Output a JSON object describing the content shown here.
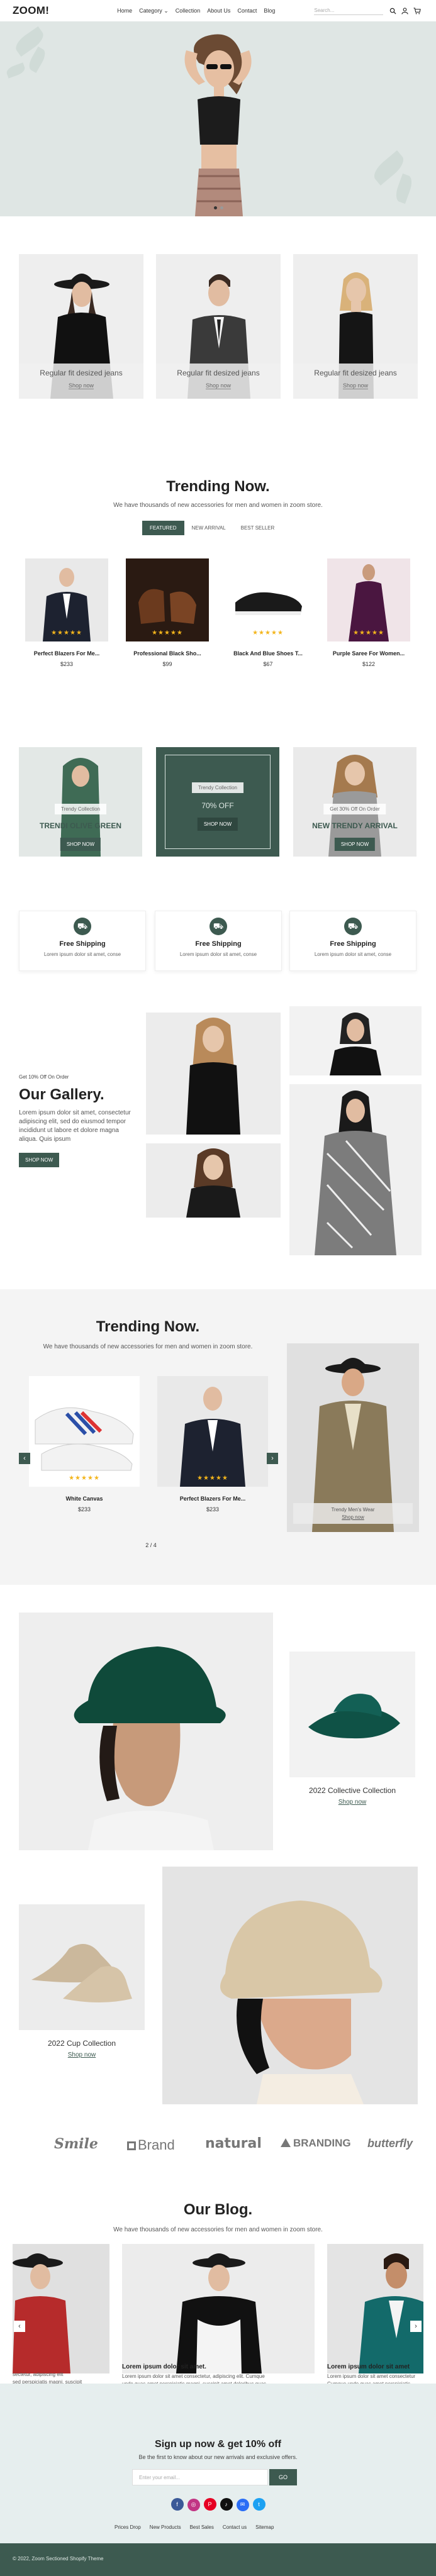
{
  "header": {
    "logo": "ZOOM!",
    "nav": [
      "Home",
      "Category",
      "Collection",
      "About Us",
      "Contact",
      "Blog"
    ],
    "category_caret": "⌄",
    "search_placeholder": "Search...",
    "icons": [
      "search-icon",
      "user-icon",
      "cart-icon"
    ]
  },
  "hero": {
    "dots": 2
  },
  "category_cards": [
    {
      "title": "Regular fit desized jeans",
      "link": "Shop now"
    },
    {
      "title": "Regular fit desized jeans",
      "link": "Shop now"
    },
    {
      "title": "Regular fit desized jeans",
      "link": "Shop now"
    }
  ],
  "trending": {
    "title": "Trending Now.",
    "subtitle": "We have thousands of new accessories for men and women in zoom store.",
    "tabs": [
      "FEATURED",
      "NEW ARRIVAL",
      "BEST SELLER"
    ],
    "products": [
      {
        "name": "Perfect Blazers For Me...",
        "price": "$233",
        "stars": "★★★★★"
      },
      {
        "name": "Professional Black Sho...",
        "price": "$99",
        "stars": "★★★★★"
      },
      {
        "name": "Black And Blue Shoes T...",
        "price": "$67",
        "stars": "★★★★★"
      },
      {
        "name": "Purple Saree For Women...",
        "price": "$122",
        "stars": "★★★★★"
      }
    ]
  },
  "promos": [
    {
      "pill": "Trendy Collection",
      "big": "TRENDI OLIVE GREEN",
      "button": "SHOP NOW"
    },
    {
      "pill": "Trendy Collection",
      "big": "70% OFF",
      "button": "SHOP NOW"
    },
    {
      "pill": "Get 30% Off On Order",
      "big": "NEW TRENDY ARRIVAL",
      "button": "SHOP NOW"
    }
  ],
  "shipping": [
    {
      "title": "Free Shipping",
      "desc": "Lorem ipsum dolor sit amet, conse"
    },
    {
      "title": "Free Shipping",
      "desc": "Lorem ipsum dolor sit amet, conse"
    },
    {
      "title": "Free Shipping",
      "desc": "Lorem ipsum dolor sit amet, conse"
    }
  ],
  "gallery": {
    "eyebrow": "Get 10% Off On Order",
    "title": "Our Gallery.",
    "text": "Lorem ipsum dolor sit amet, consectetur adipiscing elit, sed do eiusmod tempor incididunt ut labore et dolore magna aliqua. Quis ipsum",
    "button": "SHOP NOW"
  },
  "trending2": {
    "title": "Trending Now.",
    "subtitle": "We have thousands of new accessories for men and women in zoom store.",
    "products": [
      {
        "name": "White Canvas",
        "price": "$233",
        "stars": "★★★★★"
      },
      {
        "name": "Perfect Blazers For Me...",
        "price": "$233",
        "stars": "★★★★★"
      }
    ],
    "side_title": "Trendy Men's Wear",
    "side_link": "Shop now",
    "pager": "2 / 4"
  },
  "collections": [
    {
      "title": "2022 Collective Collection",
      "link": "Shop now"
    },
    {
      "title": "2022 Cup Collection",
      "link": "Shop now"
    }
  ],
  "brands": [
    "Smile",
    "Brand",
    "natural",
    "BRANDING",
    "butterfly"
  ],
  "blog": {
    "title": "Our Blog.",
    "subtitle": "We have thousands of new accessories for men and women in zoom store.",
    "posts": [
      {
        "title": "",
        "desc": "sectetur, adipiscing elit\nsed perspiciatis magni, suscipit"
      },
      {
        "title": "Lorem ipsum dolor sit amet.",
        "desc": "Lorem ipsum dolor sit amet consectetur, adipiscing elit. Cumque unde quas amet perspiciatis magni, suscipit amet doloribus quas pariatur."
      },
      {
        "title": "Lorem ipsum dolor sit amet",
        "desc": "Lorem ipsum dolor sit amet consectetur\nCumque unde quas amet perspiciatis\namet doloribus quas pariatur"
      }
    ]
  },
  "newsletter": {
    "title": "Sign up now & get 10% off",
    "subtitle": "Be the first to know about our new arrivals and exclusive offers.",
    "placeholder": "Enter your email...",
    "button": "GO"
  },
  "footer": {
    "links": [
      "Prices Drop",
      "New Products",
      "Best Sales",
      "Contact us",
      "Sitemap"
    ],
    "social": [
      "f",
      "◎",
      "P",
      "♪",
      "✉",
      "t"
    ],
    "copyright": "© 2022, Zoom Sectioned Shopify Theme"
  },
  "colors": {
    "accent": "#3d5a50",
    "hero_bg": "#dfe6e4",
    "star": "#f3b51c"
  }
}
